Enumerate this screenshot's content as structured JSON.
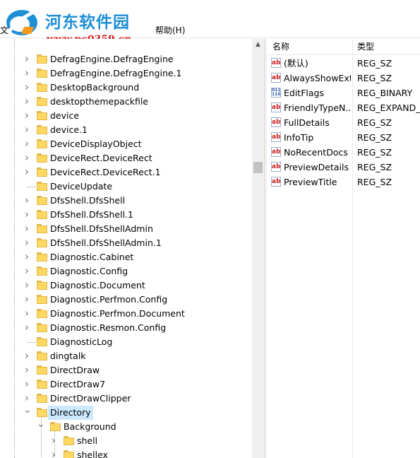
{
  "watermark": {
    "cn": "河东软件园",
    "url": "www.pc0359.cn"
  },
  "menu": {
    "file": "文",
    "help": "帮助(H)"
  },
  "tree": {
    "items": [
      {
        "label": "DefragEngine.DefragEngine",
        "level": 0,
        "chevron": "right"
      },
      {
        "label": "DefragEngine.DefragEngine.1",
        "level": 0,
        "chevron": "right"
      },
      {
        "label": "DesktopBackground",
        "level": 0,
        "chevron": "right"
      },
      {
        "label": "desktopthemepackfile",
        "level": 0,
        "chevron": "right"
      },
      {
        "label": "device",
        "level": 0,
        "chevron": "right"
      },
      {
        "label": "device.1",
        "level": 0,
        "chevron": "right"
      },
      {
        "label": "DeviceDisplayObject",
        "level": 0,
        "chevron": "right"
      },
      {
        "label": "DeviceRect.DeviceRect",
        "level": 0,
        "chevron": "right"
      },
      {
        "label": "DeviceRect.DeviceRect.1",
        "level": 0,
        "chevron": "right"
      },
      {
        "label": "DeviceUpdate",
        "level": 0,
        "chevron": "none"
      },
      {
        "label": "DfsShell.DfsShell",
        "level": 0,
        "chevron": "right"
      },
      {
        "label": "DfsShell.DfsShell.1",
        "level": 0,
        "chevron": "right"
      },
      {
        "label": "DfsShell.DfsShellAdmin",
        "level": 0,
        "chevron": "right"
      },
      {
        "label": "DfsShell.DfsShellAdmin.1",
        "level": 0,
        "chevron": "right"
      },
      {
        "label": "Diagnostic.Cabinet",
        "level": 0,
        "chevron": "right"
      },
      {
        "label": "Diagnostic.Config",
        "level": 0,
        "chevron": "right"
      },
      {
        "label": "Diagnostic.Document",
        "level": 0,
        "chevron": "right"
      },
      {
        "label": "Diagnostic.Perfmon.Config",
        "level": 0,
        "chevron": "right"
      },
      {
        "label": "Diagnostic.Perfmon.Document",
        "level": 0,
        "chevron": "right"
      },
      {
        "label": "Diagnostic.Resmon.Config",
        "level": 0,
        "chevron": "right"
      },
      {
        "label": "DiagnosticLog",
        "level": 0,
        "chevron": "none"
      },
      {
        "label": "dingtalk",
        "level": 0,
        "chevron": "right"
      },
      {
        "label": "DirectDraw",
        "level": 0,
        "chevron": "right"
      },
      {
        "label": "DirectDraw7",
        "level": 0,
        "chevron": "right"
      },
      {
        "label": "DirectDrawClipper",
        "level": 0,
        "chevron": "right"
      },
      {
        "label": "Directory",
        "level": 0,
        "chevron": "down",
        "selected": true
      },
      {
        "label": "Background",
        "level": 1,
        "chevron": "down"
      },
      {
        "label": "shell",
        "level": 2,
        "chevron": "right"
      },
      {
        "label": "shellex",
        "level": 2,
        "chevron": "right"
      }
    ]
  },
  "values": {
    "col_name": "名称",
    "col_type": "类型",
    "rows": [
      {
        "icon": "ab",
        "name": "(默认)",
        "type": "REG_SZ"
      },
      {
        "icon": "ab",
        "name": "AlwaysShowExt",
        "type": "REG_SZ"
      },
      {
        "icon": "bin",
        "name": "EditFlags",
        "type": "REG_BINARY"
      },
      {
        "icon": "ab",
        "name": "FriendlyTypeN...",
        "type": "REG_EXPAND_S"
      },
      {
        "icon": "ab",
        "name": "FullDetails",
        "type": "REG_SZ"
      },
      {
        "icon": "ab",
        "name": "InfoTip",
        "type": "REG_SZ"
      },
      {
        "icon": "ab",
        "name": "NoRecentDocs",
        "type": "REG_SZ"
      },
      {
        "icon": "ab",
        "name": "PreviewDetails",
        "type": "REG_SZ"
      },
      {
        "icon": "ab",
        "name": "PreviewTitle",
        "type": "REG_SZ"
      }
    ]
  },
  "icons": {
    "ab": "string-value-icon",
    "bin": "binary-value-icon",
    "folder": "folder-icon"
  },
  "colors": {
    "selection": "#cce8ff",
    "folder": "#ffd864",
    "watermark_cn": "#1e8fd6",
    "watermark_url": "#d32020"
  }
}
